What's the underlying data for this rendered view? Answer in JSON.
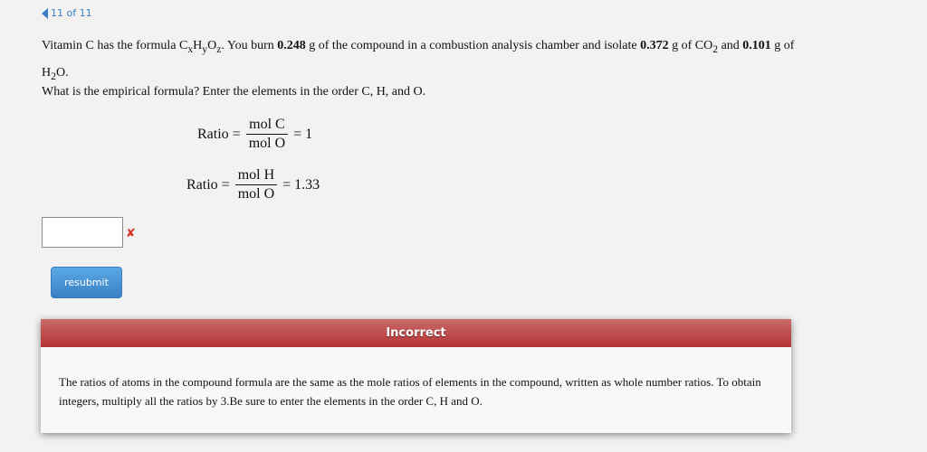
{
  "nav": {
    "counter": "11 of 11",
    "icon": "triangle-left-icon"
  },
  "question": {
    "p1_a": "Vitamin C has the formula C",
    "p1_x": "x",
    "p1_h": "H",
    "p1_y": "y",
    "p1_o": "O",
    "p1_z": "z",
    "p1_b": ". You burn ",
    "mass_compound": "0.248",
    "p1_c": " g of the compound in a combustion analysis chamber and isolate ",
    "mass_co2": "0.372",
    "p1_d": " g of CO",
    "co2_sub": "2",
    "p1_e": " and ",
    "mass_h2o": "0.101",
    "p1_f": " g of H",
    "h2o_sub": "2",
    "p1_g": "O.",
    "prompt": "What is the empirical formula? Enter the elements in the order C, H, and O."
  },
  "equations": [
    {
      "lhs": "Ratio =",
      "num": "mol C",
      "den": "mol O",
      "rhs": "= 1"
    },
    {
      "lhs": "Ratio =",
      "num": "mol H",
      "den": "mol O",
      "rhs": "= 1.33"
    }
  ],
  "answer": {
    "value": "",
    "status_icon": "x-mark-icon",
    "status_symbol": "✘"
  },
  "resubmit_label": "resubmit",
  "feedback": {
    "title": "Incorrect",
    "body": "The ratios of atoms in the compound formula are the same as the mole ratios of elements in the compound, written as whole number ratios. To obtain integers, multiply all the ratios by 3.Be sure to enter the elements in the order C, H and O."
  }
}
